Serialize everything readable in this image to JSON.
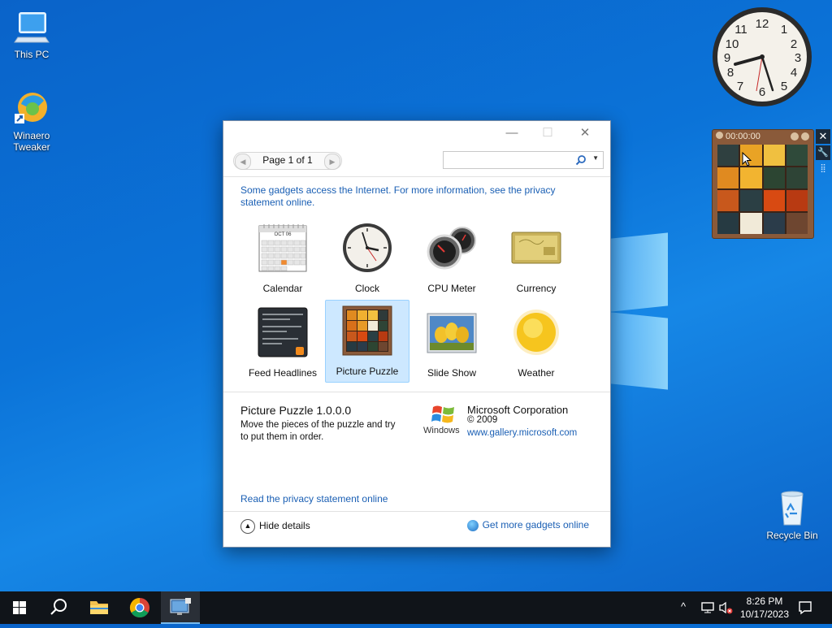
{
  "desktop": {
    "icons": [
      {
        "label": "This PC"
      },
      {
        "label": "Winaero Tweaker"
      },
      {
        "label": "Recycle Bin"
      }
    ]
  },
  "clock_gadget": {
    "time_hint": "8:26"
  },
  "puzzle_gadget": {
    "timer": "00:00:00"
  },
  "window": {
    "pager": {
      "text": "Page 1 of 1"
    },
    "search": {
      "placeholder": "",
      "value": ""
    },
    "notice": {
      "text": "Some gadgets access the Internet.  For more information, see the privacy statement online."
    },
    "gadgets": [
      {
        "label": "Calendar"
      },
      {
        "label": "Clock"
      },
      {
        "label": "CPU Meter"
      },
      {
        "label": "Currency"
      },
      {
        "label": "Feed Headlines"
      },
      {
        "label": "Picture Puzzle"
      },
      {
        "label": "Slide Show"
      },
      {
        "label": "Weather"
      }
    ],
    "selected_gadget": "Picture Puzzle",
    "details": {
      "title": "Picture Puzzle 1.0.0.0",
      "description": "Move the pieces of the puzzle and try to put them in order.",
      "publisher": "Microsoft Corporation",
      "copyright": "© 2009",
      "url": "www.gallery.microsoft.com",
      "windows_logo_text": "Windows"
    },
    "privacy_link": "Read the privacy statement online",
    "hide_details": "Hide details",
    "more_gadgets": "Get more gadgets online",
    "calendar_month": "OCT 06"
  },
  "taskbar": {
    "time": "8:26 PM",
    "date": "10/17/2023"
  },
  "colors": {
    "link": "#1a5fb4",
    "selection": "#cde8ff",
    "taskbar": "#101419",
    "desktop": "#0b73d8"
  }
}
